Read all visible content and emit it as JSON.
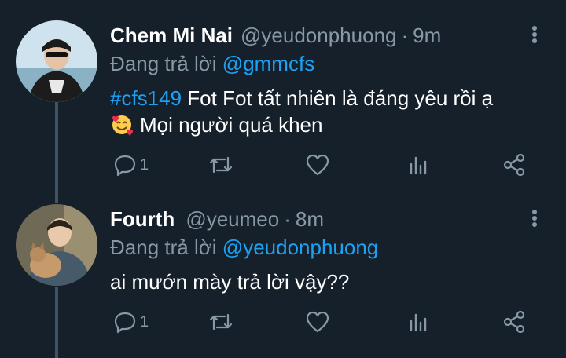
{
  "tweets": [
    {
      "display_name": "Chem Mi Nai",
      "handle": "@yeudonphuong",
      "separator": "·",
      "time": "9m",
      "reply_prefix": "Đang trả lời",
      "reply_to": "@gmmcfs",
      "hashtag": "#cfs149",
      "text_line1": " Fot Fot tất nhiên là đáng yêu rồi ạ",
      "text_line2": "Mọi người quá khen",
      "emoji": "smiling-face-with-hearts",
      "reply_count": "1"
    },
    {
      "display_name": "Fourth",
      "handle": "@yeumeo",
      "separator": "·",
      "time": "8m",
      "reply_prefix": "Đang trả lời",
      "reply_to": "@yeudonphuong",
      "text_line1": "ai mướn mày trả lời vậy??",
      "reply_count": "1"
    }
  ],
  "icons": [
    "reply-icon",
    "retweet-icon",
    "like-icon",
    "analytics-icon",
    "share-icon",
    "more-icon"
  ],
  "colors": {
    "background": "#15202b",
    "text": "#ffffff",
    "secondary": "#8899a6",
    "accent": "#1da1f2",
    "thread_line": "#3d5466"
  }
}
